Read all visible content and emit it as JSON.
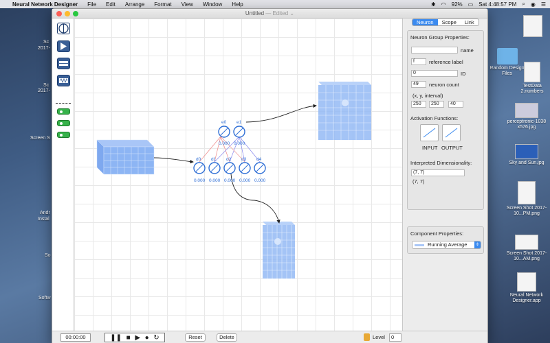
{
  "menubar": {
    "app_name": "Neural Network Designer",
    "items": [
      "File",
      "Edit",
      "Arrange",
      "Format",
      "View",
      "Window",
      "Help"
    ],
    "battery": "92%",
    "clock": "Sat 4:48:57 PM"
  },
  "window": {
    "title": "Untitled",
    "edited": "— Edited ⌄"
  },
  "canvas": {
    "top_neurons": [
      "e0",
      "e1"
    ],
    "top_values": [
      "0.000",
      "0.000"
    ],
    "bottom_neurons": [
      "d0",
      "d1",
      "d2",
      "d3",
      "d4"
    ],
    "bottom_values": [
      "0.000",
      "0.000",
      "0.000",
      "0.000",
      "0.000"
    ]
  },
  "inspector": {
    "tabs": [
      "Neuron",
      "Scope",
      "Link"
    ],
    "active_tab": "Neuron",
    "group_title": "Neuron Group Properties:",
    "name_label": "name",
    "name_value": "",
    "ref_value": "f",
    "ref_label": "reference label",
    "id_value": "0",
    "id_label": "ID",
    "count_value": "49",
    "count_label": "neuron count",
    "xyi_label": "(x, y, interval)",
    "x_value": "250",
    "y_value": "250",
    "interval_value": "40",
    "activation_title": "Activation Functions:",
    "input_label": "INPUT",
    "output_label": "OUTPUT",
    "dim_title": "Interpreted Dimensionality:",
    "dim_field": "(7, 7)",
    "dim_text": "(7, 7)",
    "component_title": "Component Properties:",
    "component_value": "Running Average"
  },
  "bottombar": {
    "timer": "00:00:00",
    "reset": "Reset",
    "delete": "Delete",
    "level_label": "Level",
    "level_value": "0"
  },
  "desktop_right": [
    {
      "label": "Random Design Files"
    },
    {
      "label": "TestData 2.numbers"
    },
    {
      "label": "perceptronic-1038 x576.jpg"
    },
    {
      "label": "Sky and Sun.jpg"
    },
    {
      "label": "Screen Shot 2017-10...PM.png"
    },
    {
      "label": "Screen Shot 2017-10...AM.png"
    },
    {
      "label": "Neural Network Designer.app"
    }
  ],
  "desktop_left": [
    "Sc",
    "2017-",
    "Sc",
    "2017-",
    "Screen S",
    "Andr",
    "Instal",
    "So",
    "Softw"
  ],
  "colors": {
    "accent": "#3b8bf0",
    "neuron": "#2f6fd6",
    "grid_cube": "#7eaaf5",
    "tool_blue": "#3a5f96",
    "tool_green": "#36b24a"
  }
}
